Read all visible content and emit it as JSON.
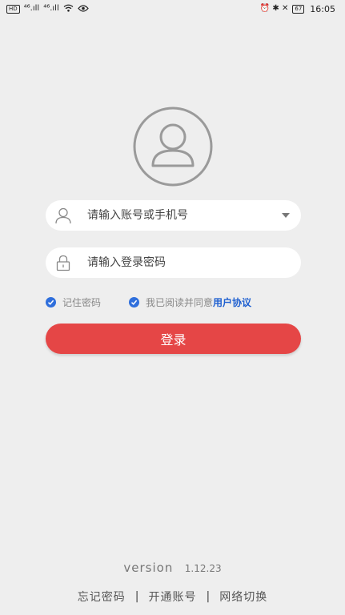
{
  "status_bar": {
    "left_chip": "HD",
    "signal_1": "⁴⁶.ıll",
    "signal_2": "⁴⁶.ıll",
    "wifi_icon": "wifi-icon",
    "eye_icon": "eye-icon",
    "right_icons": "⏰ ✱ ✕",
    "battery_level": "67",
    "time": "16:05"
  },
  "login": {
    "avatar_icon": "user-avatar-icon",
    "account_placeholder": "请输入账号或手机号",
    "account_value": "",
    "password_placeholder": "请输入登录密码",
    "password_value": "",
    "remember_label": "记住密码",
    "agreement_text": "我已阅读并同意",
    "agreement_link": "用户协议",
    "login_button": "登录"
  },
  "footer": {
    "version_label": "version",
    "version_number": "1.12.23",
    "forgot_password": "忘记密码",
    "separator": "|",
    "open_account": "开通账号",
    "network_switch": "网络切换"
  },
  "colors": {
    "accent": "#e54646",
    "link": "#1e5fd0",
    "check": "#2f6fdc",
    "background": "#eeeeee"
  }
}
